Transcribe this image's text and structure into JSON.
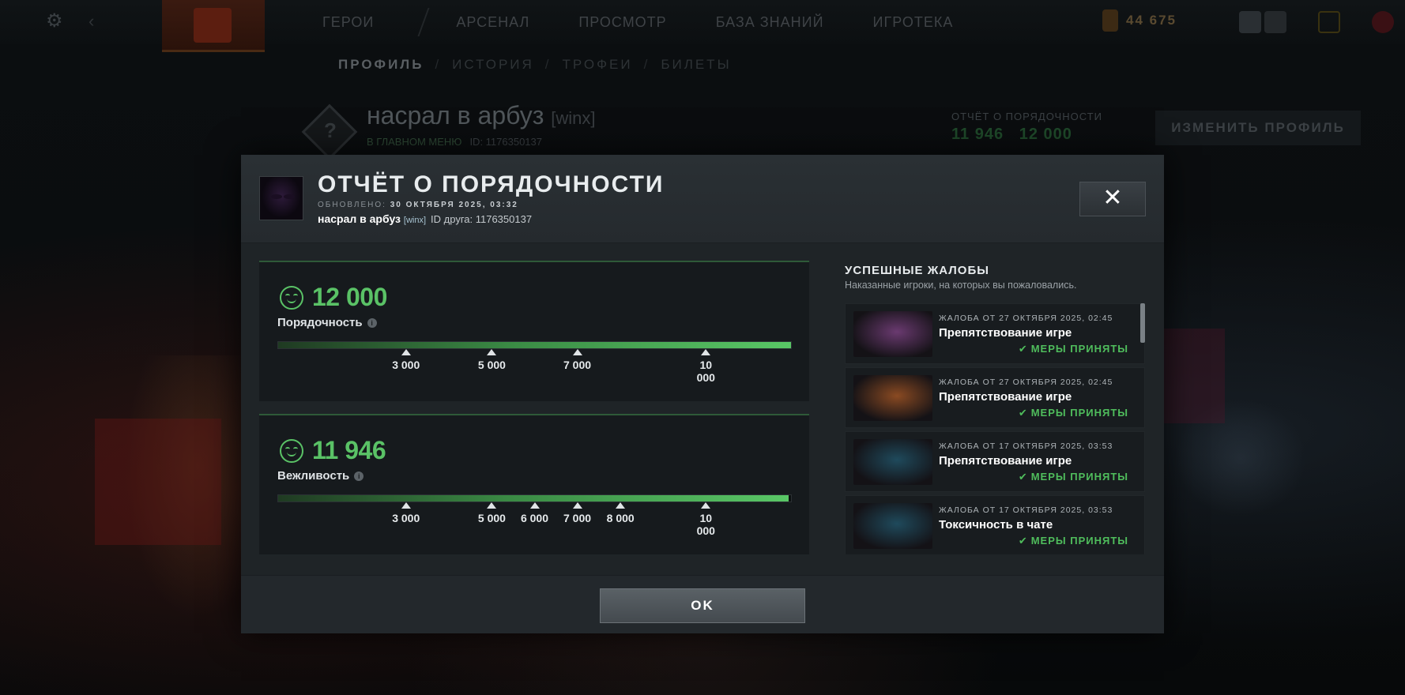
{
  "background": {
    "nav": [
      "ГЕРОИ",
      "АРСЕНАЛ",
      "ПРОСМОТР",
      "БАЗА ЗНАНИЙ",
      "ИГРОТЕКА"
    ],
    "currency": "44  675",
    "subnav": [
      "ПРОФИЛЬ",
      "ИСТОРИЯ",
      "ТРОФЕИ",
      "БИЛЕТЫ"
    ],
    "profile_name": "насрал в арбуз",
    "profile_tag": "[winx]",
    "profile_status": "В ГЛАВНОМ МЕНЮ",
    "profile_id": "ID: 1176350137",
    "conduct_label": "ОТЧЁТ О ПОРЯДОЧНОСТИ",
    "conduct_behavior": "11 946",
    "conduct_comm": "12 000",
    "edit_profile": "ИЗМЕНИТЬ ПРОФИЛЬ"
  },
  "modal": {
    "title": "ОТЧЁТ О ПОРЯДОЧНОСТИ",
    "updated_label": "ОБНОВЛЕНО:",
    "updated_date": "30 ОКТЯБРЯ 2025, 03:32",
    "user_name": "насрал в арбуз",
    "user_tag": "[winx]",
    "friend_id": "ID друга: 1176350137",
    "close_icon": "close-icon",
    "ok_label": "OK"
  },
  "stats": [
    {
      "value": "12 000",
      "label": "Порядочность",
      "fill_percent": 100,
      "ticks": [
        {
          "label": "3 000",
          "pos": 0.25
        },
        {
          "label": "5 000",
          "pos": 0.417
        },
        {
          "label": "7 000",
          "pos": 0.583
        },
        {
          "label": "10 000",
          "pos": 0.833
        }
      ]
    },
    {
      "value": "11 946",
      "label": "Вежливость",
      "fill_percent": 99.55,
      "ticks": [
        {
          "label": "3 000",
          "pos": 0.25
        },
        {
          "label": "5 000",
          "pos": 0.417
        },
        {
          "label": "6 000",
          "pos": 0.5
        },
        {
          "label": "7 000",
          "pos": 0.583
        },
        {
          "label": "8 000",
          "pos": 0.667
        },
        {
          "label": "10 000",
          "pos": 0.833
        }
      ]
    }
  ],
  "reports": {
    "title": "УСПЕШНЫЕ ЖАЛОБЫ",
    "subtitle": "Наказанные игроки, на которых вы пожаловались.",
    "items": [
      {
        "date": "ЖАЛОБА ОТ 27 ОКТЯБРЯ 2025, 02:45",
        "type": "Препятствование игре",
        "status": "МЕРЫ ПРИНЯТЫ",
        "hero_color": "#6a3a70"
      },
      {
        "date": "ЖАЛОБА ОТ 27 ОКТЯБРЯ 2025, 02:45",
        "type": "Препятствование игре",
        "status": "МЕРЫ ПРИНЯТЫ",
        "hero_color": "#8a4a22"
      },
      {
        "date": "ЖАЛОБА ОТ 17 ОКТЯБРЯ 2025, 03:53",
        "type": "Препятствование игре",
        "status": "МЕРЫ ПРИНЯТЫ",
        "hero_color": "#1f4a5c"
      },
      {
        "date": "ЖАЛОБА ОТ 17 ОКТЯБРЯ 2025, 03:53",
        "type": "Токсичность в чате",
        "status": "МЕРЫ ПРИНЯТЫ",
        "hero_color": "#1f4a5c"
      }
    ]
  },
  "colors": {
    "accent_green": "#5ac266",
    "status_green": "#4fbd5c"
  }
}
